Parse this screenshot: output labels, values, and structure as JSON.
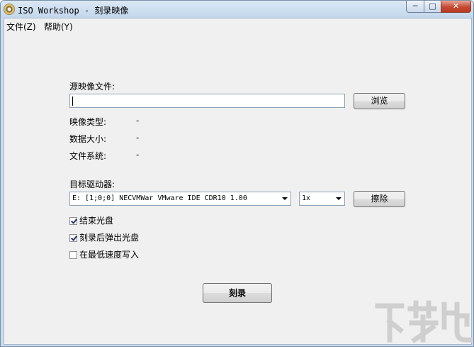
{
  "window": {
    "title": "ISO Workshop - 刻录映像",
    "controls": {
      "minimize": "─",
      "maximize": "□",
      "close": "✕"
    },
    "icon": "disc-icon"
  },
  "menu": {
    "file": "文件(Z)",
    "help": "帮助(Y)"
  },
  "source": {
    "label": "源映像文件:",
    "value": "",
    "browse_label": "浏览"
  },
  "info": {
    "image_type_label": "映像类型:",
    "image_type_value": "-",
    "data_size_label": "数据大小:",
    "data_size_value": "-",
    "filesystem_label": "文件系统:",
    "filesystem_value": "-"
  },
  "target": {
    "label": "目标驱动器:",
    "drive_value": "E:  [1;0;0] NECVMWar VMware IDE CDR10 1.00",
    "speed_value": "1x",
    "erase_label": "擦除"
  },
  "options": {
    "finalize_label": "结束光盘",
    "finalize_checked": true,
    "eject_label": "刻录后弹出光盘",
    "eject_checked": true,
    "min_speed_label": "在最低速度写入",
    "min_speed_checked": false
  },
  "burn_label": "刻录",
  "watermark": {
    "text": "下载吧",
    "color": "#cfcfcf"
  }
}
